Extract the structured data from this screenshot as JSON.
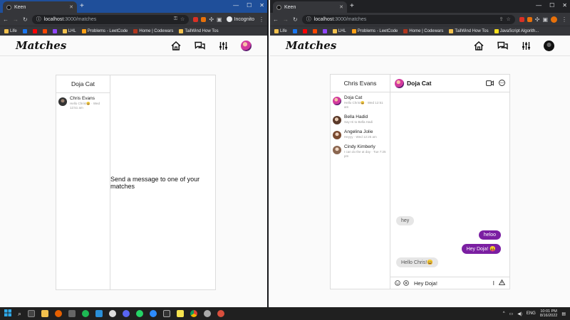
{
  "taskbar": {
    "lang": "ENG",
    "time": "10:01 PM",
    "date": "8/16/2022"
  },
  "windows": [
    {
      "tab": {
        "title": "Keen"
      },
      "url": {
        "host": "localhost",
        "path": ":3000/matches"
      },
      "incognito_label": "Incognito",
      "bookmarks": [
        "Life",
        "LHL",
        "Problems - LeetCode",
        "Home | Codewars",
        "TailWind How Tos"
      ],
      "app": {
        "logo": "Matches",
        "match_header": "Doja Cat",
        "matches": [
          {
            "name": "Chris Evans",
            "preview": "Hello Chris!😄",
            "sep": "·",
            "time": "Wed 12:51 am"
          }
        ],
        "empty_text": "Send a message to one of your matches"
      }
    },
    {
      "tab": {
        "title": "Keen"
      },
      "url": {
        "host": "localhost",
        "path": ":3000/matches"
      },
      "bookmarks": [
        "Life",
        "LHL",
        "Problems - LeetCode",
        "Home | Codewars",
        "TailWind How Tos",
        "JavaScript Algorith..."
      ],
      "app": {
        "logo": "Matches",
        "match_header": "Chris Evans",
        "chat_name": "Doja Cat",
        "matches": [
          {
            "name": "Doja Cat",
            "preview": "Hello Chris!😄",
            "sep": "·",
            "time": "Wed 12:51 am"
          },
          {
            "name": "Bella Hadid",
            "preview": "Say Hi to Bella Hadi",
            "sep": "",
            "time": ""
          },
          {
            "name": "Angelina Jolie",
            "preview": "Heyyy",
            "sep": "·",
            "time": "Wed 12:25 am"
          },
          {
            "name": "Cindy Kimberly",
            "preview": "I can do the at day",
            "sep": "·",
            "time": "Tue 7:25 pm"
          }
        ],
        "messages": [
          {
            "text": "hey"
          },
          {
            "text": "heloo"
          },
          {
            "text": "Hey Doja! 😛"
          },
          {
            "text": "Hello Chris!😄"
          }
        ],
        "composer_value": "Hey Doja!"
      }
    }
  ]
}
